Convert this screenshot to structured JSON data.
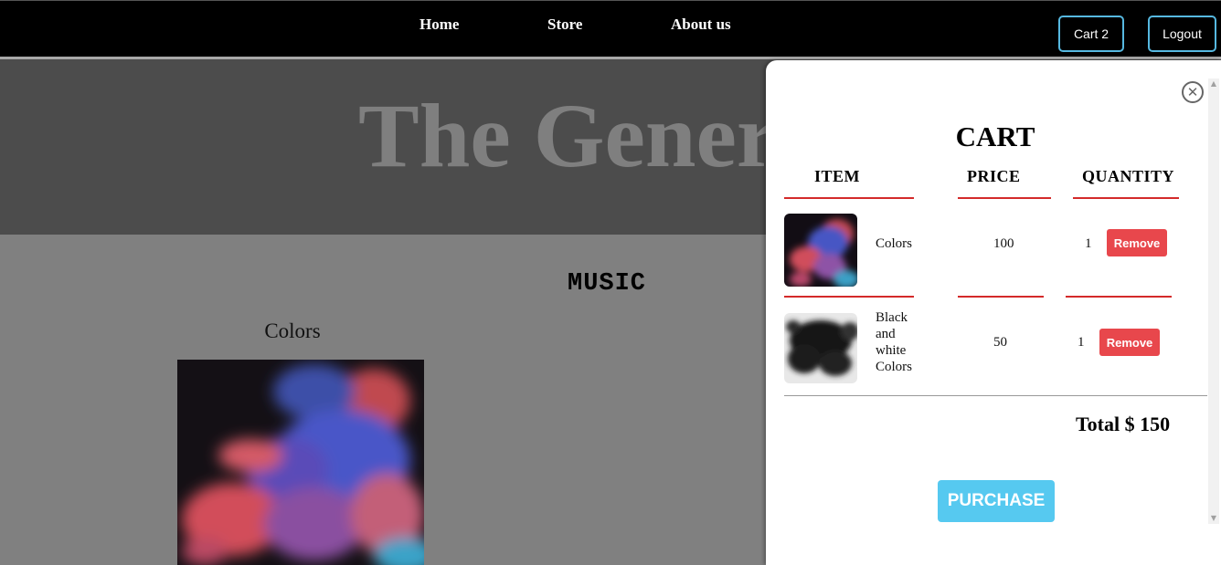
{
  "nav": {
    "links": [
      "Home",
      "Store",
      "About us"
    ],
    "cart_button": "Cart 2",
    "logout_button": "Logout"
  },
  "hero": {
    "title": "The Generics"
  },
  "section": {
    "title": "MUSIC"
  },
  "products": [
    {
      "title": "Colors"
    }
  ],
  "cart": {
    "title": "CART",
    "close_icon": "close-circle-icon",
    "headers": {
      "item": "ITEM",
      "price": "PRICE",
      "quantity": "QUANTITY"
    },
    "items": [
      {
        "name": "Colors",
        "price": "100",
        "quantity": "1",
        "remove_label": "Remove"
      },
      {
        "name": "Black and white Colors",
        "price": "50",
        "quantity": "1",
        "remove_label": "Remove"
      }
    ],
    "total": "Total $ 150",
    "purchase_label": "PURCHASE"
  },
  "colors": {
    "nav_bg": "#000000",
    "button_border": "#56b8e0",
    "remove_bg": "#e8474c",
    "purchase_bg": "#56c9f0",
    "divider_red": "#d42a2a"
  }
}
